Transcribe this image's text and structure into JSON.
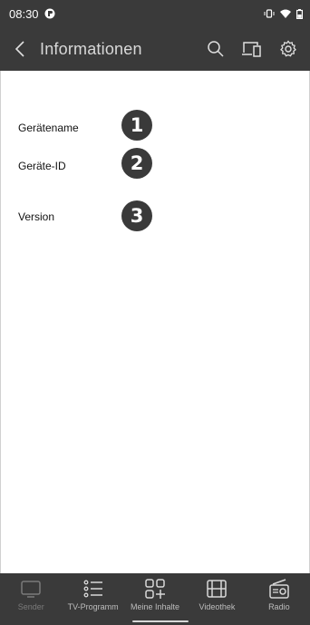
{
  "status_bar": {
    "time": "08:30"
  },
  "header": {
    "title": "Informationen"
  },
  "info": {
    "rows": [
      {
        "label": "Gerätename",
        "marker": "1"
      },
      {
        "label": "Geräte-ID",
        "marker": "2"
      },
      {
        "label": "Version",
        "marker": "3"
      }
    ]
  },
  "bottom_nav": {
    "items": [
      {
        "label": "Sender",
        "icon": "tv-icon"
      },
      {
        "label": "TV-Programm",
        "icon": "list-icon"
      },
      {
        "label": "Meine Inhalte",
        "icon": "grid-add-icon"
      },
      {
        "label": "Videothek",
        "icon": "film-icon"
      },
      {
        "label": "Radio",
        "icon": "radio-icon"
      }
    ]
  },
  "colors": {
    "bar": "#3a3a3a",
    "marker": "#3a3a3a",
    "background": "#ffffff"
  }
}
